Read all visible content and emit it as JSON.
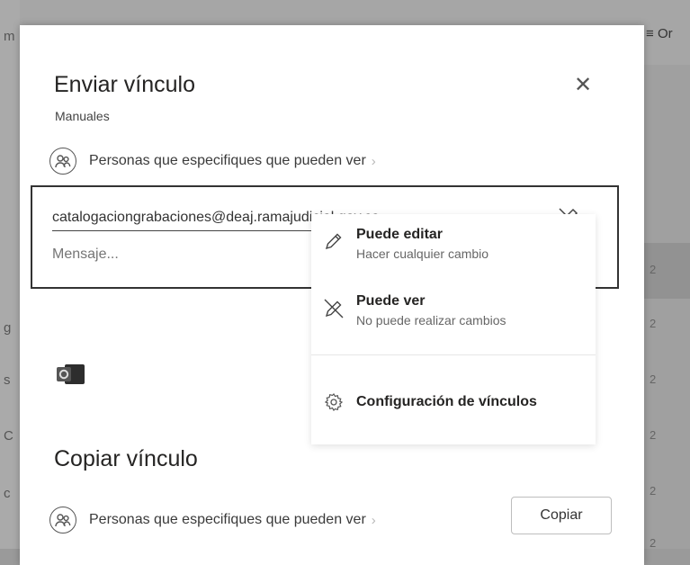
{
  "background": {
    "sort_label": "Or",
    "left_letters": [
      "m",
      "g",
      "s",
      "C",
      "c"
    ],
    "row_numbers": [
      "2",
      "2",
      "2",
      "2",
      "2",
      "2"
    ]
  },
  "dialog": {
    "title": "Enviar vínculo",
    "subtitle": "Manuales",
    "permission_label": "Personas que especifiques que pueden ver",
    "recipient_value": "catalogaciongrabaciones@deaj.ramajudicial.gov.co",
    "message_placeholder": "Mensaje...",
    "copy_title": "Copiar vínculo",
    "copy_permission_label": "Personas que especifiques que pueden ver",
    "copy_button": "Copiar"
  },
  "menu": {
    "items": [
      {
        "title": "Puede editar",
        "desc": "Hacer cualquier cambio",
        "icon": "pencil-icon"
      },
      {
        "title": "Puede ver",
        "desc": "No puede realizar cambios",
        "icon": "no-edit-icon"
      }
    ],
    "settings": "Configuración de vínculos"
  },
  "colors": {
    "dialog_bg": "#ffffff",
    "border": "#333333",
    "backdrop": "#a0a0a0"
  }
}
